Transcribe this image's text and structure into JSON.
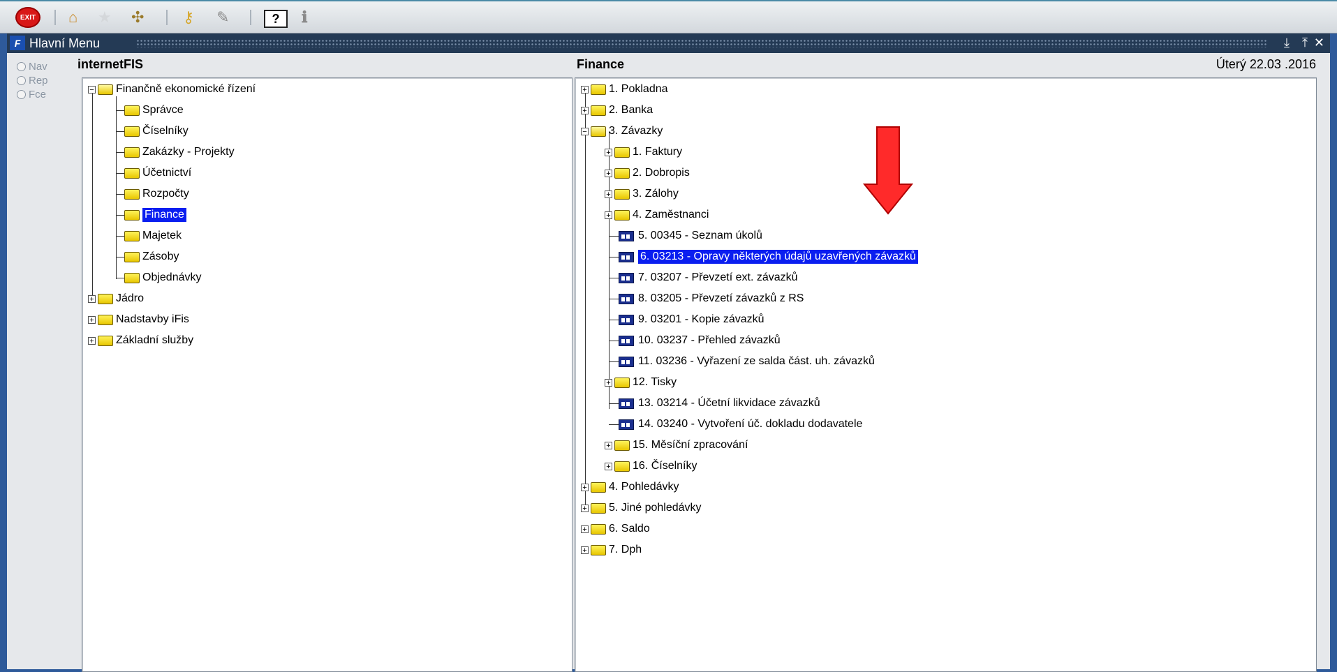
{
  "toolbar": {
    "exit_label": "EXIT",
    "icons": [
      "exit-icon",
      "home-icon",
      "star-icon",
      "network-icon",
      "key-icon",
      "tools-icon",
      "help-icon",
      "info-icon"
    ]
  },
  "window": {
    "title": "Hlavní Menu"
  },
  "modes": [
    {
      "label": "Nav"
    },
    {
      "label": "Rep"
    },
    {
      "label": "Fce"
    }
  ],
  "left": {
    "header": "internetFIS",
    "root": "Finančně ekonomické řízení",
    "children": [
      "Správce",
      "Číselníky",
      "Zakázky - Projekty",
      "Účetnictví",
      "Rozpočty",
      "Finance",
      "Majetek",
      "Zásoby",
      "Objednávky"
    ],
    "selected": "Finance",
    "others": [
      "Jádro",
      "Nadstavby iFis",
      "Základní služby"
    ]
  },
  "right": {
    "header": "Finance",
    "date": "Úterý  22.03 .2016",
    "items": [
      {
        "label": "1.  Pokladna"
      },
      {
        "label": "2.  Banka"
      },
      {
        "label": "3.  Závazky"
      },
      {
        "label": "1.  Faktury"
      },
      {
        "label": "2.  Dobropis"
      },
      {
        "label": "3.  Zálohy"
      },
      {
        "label": "4.  Zaměstnanci"
      },
      {
        "label": "5.  00345 - Seznam úkolů"
      },
      {
        "label": "6.  03213 - Opravy některých údajů uzavřených závazků"
      },
      {
        "label": "7.  03207 - Převzetí ext. závazků"
      },
      {
        "label": "8.  03205 - Převzetí závazků z RS"
      },
      {
        "label": "9.  03201 - Kopie závazků"
      },
      {
        "label": "10. 03237 - Přehled závazků"
      },
      {
        "label": "11. 03236 - Vyřazení ze salda část. uh. závazků"
      },
      {
        "label": "12. Tisky"
      },
      {
        "label": "13. 03214 - Účetní likvidace závazků"
      },
      {
        "label": "14. 03240 - Vytvoření úč. dokladu dodavatele"
      },
      {
        "label": "15. Měsíční zpracování"
      },
      {
        "label": "16. Číselníky"
      },
      {
        "label": "4.  Pohledávky"
      },
      {
        "label": "5.  Jiné pohledávky"
      },
      {
        "label": "6.  Saldo"
      },
      {
        "label": "7.  Dph"
      }
    ]
  },
  "colors": {
    "selection": "#0a1ef0",
    "arrow": "#ff2a2a",
    "titlebar": "#243a55"
  }
}
